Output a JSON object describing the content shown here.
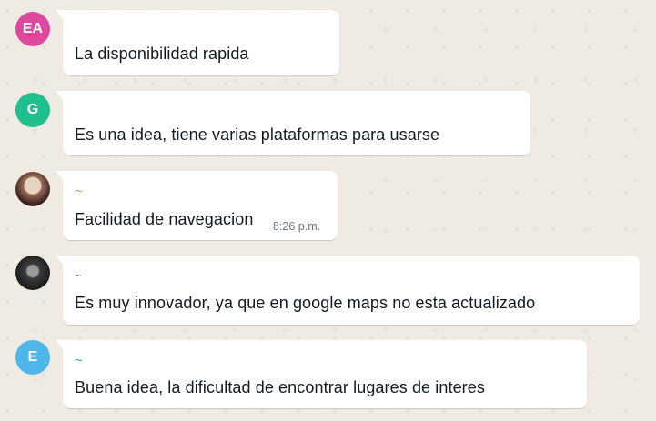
{
  "colors": {
    "avatar_ea": "#e0489f",
    "avatar_g": "#1fbf8f",
    "avatar_e": "#4fb6ea",
    "tilde_olive": "#a3a34a",
    "tilde_blue": "#3b8ed6"
  },
  "messages": [
    {
      "avatar_initials": "EA",
      "text": "La disponibilidad rapida"
    },
    {
      "avatar_initials": "G",
      "text": "Es una idea, tiene varias plataformas para usarse"
    },
    {
      "avatar_icon": "user-photo-icon",
      "sender": "~",
      "text": "Facilidad de navegacion",
      "time": "8:26 p.m."
    },
    {
      "avatar_icon": "user-photo-icon",
      "sender": "~",
      "text": "Es muy innovador, ya que en google maps no esta actualizado"
    },
    {
      "avatar_initials": "E",
      "sender": "~",
      "text": "Buena idea, la dificultad de encontrar lugares de interes"
    }
  ]
}
